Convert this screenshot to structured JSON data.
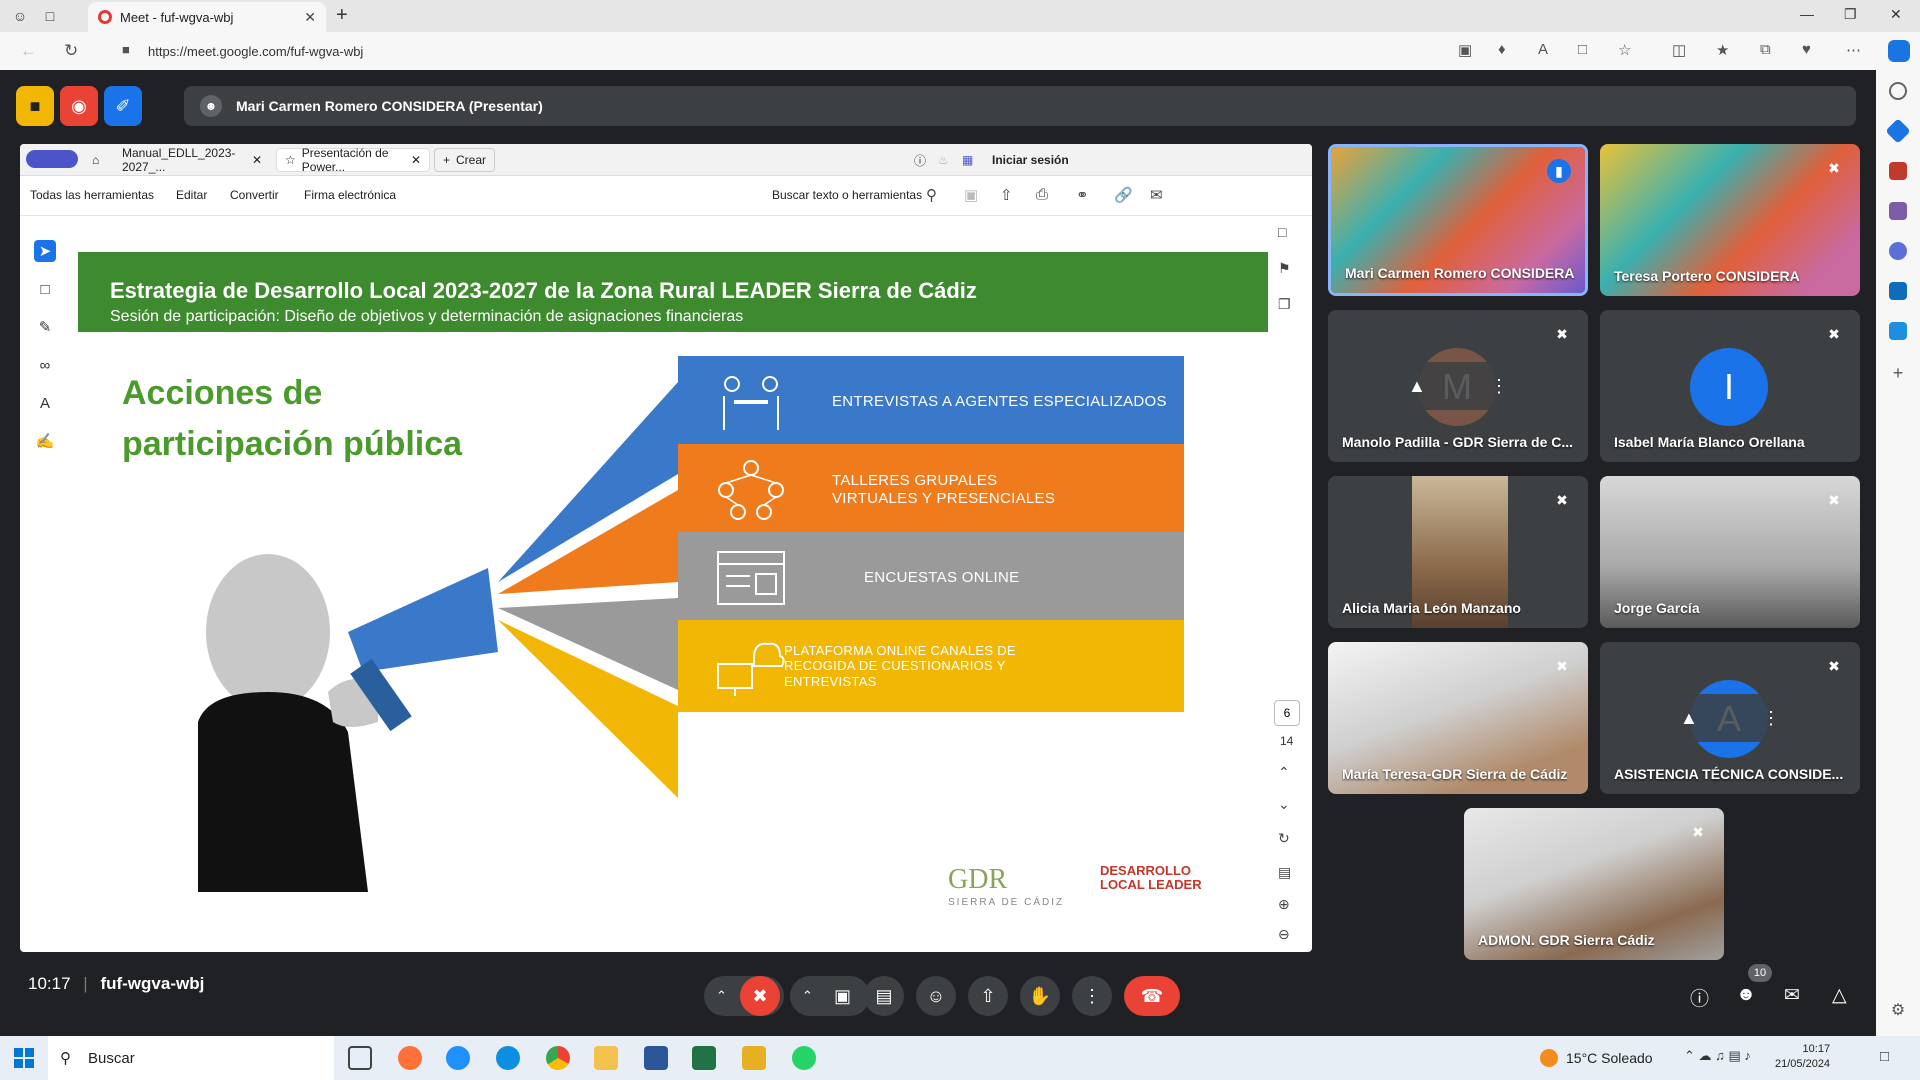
{
  "browser": {
    "tab_title": "Meet - fuf-wgva-wbj",
    "url": "https://meet.google.com/fuf-wgva-wbj"
  },
  "meet": {
    "presenter_label": "Mari Carmen Romero CONSIDERA (Presentar)",
    "clock": "10:17",
    "meeting_code": "fuf-wgva-wbj",
    "people_count": "10",
    "accent_red": "#ea4335",
    "accent_blue": "#8ab4f8"
  },
  "pdf": {
    "tabs": [
      {
        "label": "Manual_EDLL_2023-2027_..."
      },
      {
        "label": "Presentación de Power..."
      },
      {
        "label": "Crear"
      }
    ],
    "sign_in": "Iniciar sesión",
    "toolbar": {
      "all_tools": "Todas las herramientas",
      "edit": "Editar",
      "convert": "Convertir",
      "esign": "Firma electrónica",
      "search": "Buscar texto o herramientas"
    },
    "page_current": "6",
    "page_total": "14"
  },
  "slide": {
    "title": "Estrategia de Desarrollo Local 2023-2027 de la Zona Rural LEADER Sierra de Cádiz",
    "subtitle": "Sesión de participación:  Diseño de objetivos y determinación de asignaciones financieras",
    "heading_line1": "Acciones de",
    "heading_line2": "participación pública",
    "bands": [
      {
        "text": "ENTREVISTAS A AGENTES ESPECIALIZADOS",
        "color": "#3a78c9"
      },
      {
        "text": "TALLERES GRUPALES VIRTUALES Y PRESENCIALES",
        "color": "#f07b1d"
      },
      {
        "text": "ENCUESTAS ONLINE",
        "color": "#9a9a9a"
      },
      {
        "text": "PLATAFORMA ONLINE CANALES DE RECOGIDA DE CUESTIONARIOS Y ENTREVISTAS",
        "color": "#f2b705"
      }
    ],
    "logo_gdr": "GDR",
    "logo_gdr_sub": "SIERRA DE CÁDIZ",
    "logo_edl_1": "DESARROLLO",
    "logo_edl_2": "LOCAL LEADER"
  },
  "participants": [
    {
      "name": "Mari Carmen Romero CONSIDERA",
      "type": "camera"
    },
    {
      "name": "Teresa Portero CONSIDERA",
      "type": "camera"
    },
    {
      "name": "Manolo Padilla - GDR Sierra de C...",
      "type": "avatar",
      "initial": "M",
      "color": "#795548"
    },
    {
      "name": "Isabel María Blanco Orellana",
      "type": "avatar",
      "initial": "I",
      "color": "#1a73e8"
    },
    {
      "name": "Alicia Maria León Manzano",
      "type": "camera"
    },
    {
      "name": "Jorge García",
      "type": "camera"
    },
    {
      "name": "María Teresa-GDR Sierra de Cádiz",
      "type": "camera"
    },
    {
      "name": "ASISTENCIA TÉCNICA CONSIDE...",
      "type": "avatar",
      "initial": "A",
      "color": "#1a73e8"
    },
    {
      "name": "ADMON. GDR Sierra Cádiz",
      "type": "camera"
    }
  ],
  "taskbar": {
    "search": "Buscar",
    "weather": "15°C  Soleado",
    "time": "10:17",
    "date": "21/05/2024"
  }
}
